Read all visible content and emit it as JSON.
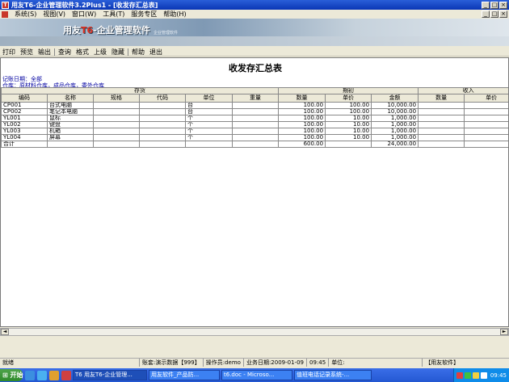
{
  "window": {
    "title": "用友T6-企业管理软件3.2Plus1 - [收发存汇总表]",
    "icon_label": "T"
  },
  "menu": [
    "系统(S)",
    "视图(V)",
    "窗口(W)",
    "工具(T)",
    "服务专区",
    "帮助(H)"
  ],
  "banner": {
    "brand": "用友",
    "t6": "T6",
    "suffix": "-企业管理软件",
    "sub": "企业管理软件"
  },
  "toolbar": [
    "打印",
    "预览",
    "输出",
    "查询",
    "格式",
    "上级",
    "隐藏",
    "帮助",
    "退出"
  ],
  "report": {
    "title": "收发存汇总表",
    "date_label": "记账日期：全部",
    "warehouse_label": "仓库：原材料仓库，成品仓库，委外仓库",
    "group_headers": [
      "存货",
      "期初",
      "收入"
    ],
    "columns": [
      "编码",
      "名称",
      "规格",
      "代码",
      "单位",
      "重量",
      "数量",
      "单价",
      "金额",
      "数量",
      "单价"
    ],
    "rows": [
      [
        "CP001",
        "台式电脑",
        "",
        "",
        "台",
        "",
        "100.00",
        "100.00",
        "10,000.00",
        "",
        ""
      ],
      [
        "CP002",
        "笔记本电脑",
        "",
        "",
        "台",
        "",
        "100.00",
        "100.00",
        "10,000.00",
        "",
        ""
      ],
      [
        "YL001",
        "鼠标",
        "",
        "",
        "个",
        "",
        "100.00",
        "10.00",
        "1,000.00",
        "",
        ""
      ],
      [
        "YL002",
        "键盘",
        "",
        "",
        "个",
        "",
        "100.00",
        "10.00",
        "1,000.00",
        "",
        ""
      ],
      [
        "YL003",
        "机箱",
        "",
        "",
        "个",
        "",
        "100.00",
        "10.00",
        "1,000.00",
        "",
        ""
      ],
      [
        "YL004",
        "屏幕",
        "",
        "",
        "个",
        "",
        "100.00",
        "10.00",
        "1,000.00",
        "",
        ""
      ],
      [
        "合计",
        "",
        "",
        "",
        "",
        "",
        "600.00",
        "",
        "24,000.00",
        "",
        ""
      ]
    ]
  },
  "statusbar": {
    "ready": "就绪",
    "account": "账套:演示数据【999】",
    "operator": "操作员:demo",
    "business_date": "业务日期:2009-01-09",
    "time": "09:45",
    "unit": "单位:",
    "brand": "【用友软件】"
  },
  "taskbar": {
    "start": "开始",
    "tasks": [
      "T6 用友T6-企业管理...",
      "用友软件_产品防...",
      "t6.doc - Microso...",
      "值班电话记录系统-..."
    ],
    "clock": "09:45"
  },
  "colors": {
    "titlebar": "#0a36b5",
    "taskbar": "#2458d2",
    "start": "#2f8a2b",
    "link_text": "#0000a0"
  }
}
